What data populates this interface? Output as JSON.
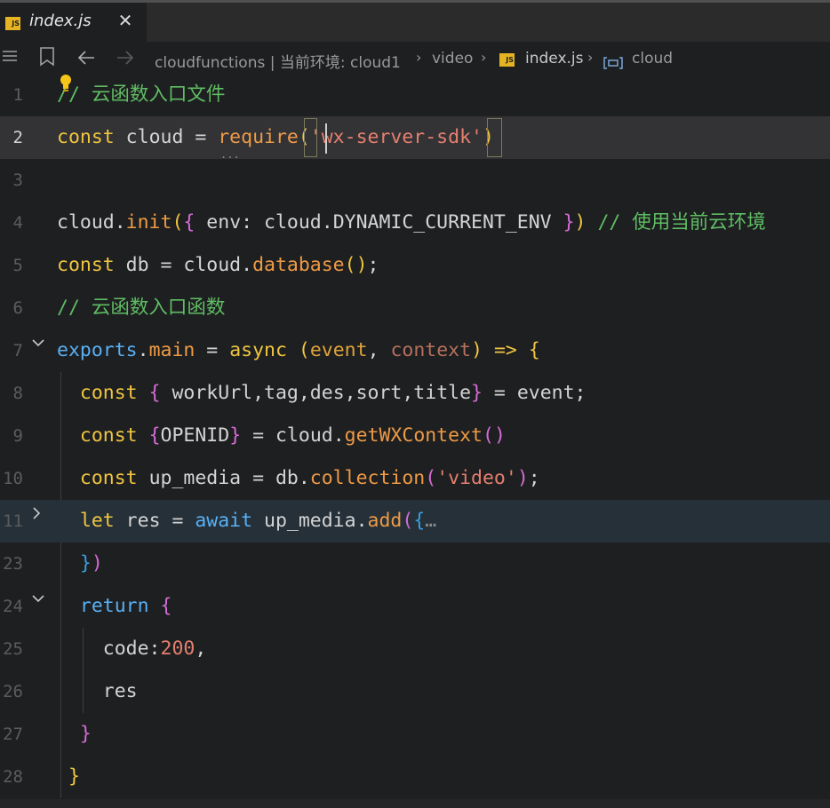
{
  "tab": {
    "icon": "js-file-icon",
    "badge": "JS",
    "name": "index.js",
    "close": "✕"
  },
  "breadcrumb": {
    "icons": [
      "menu-icon",
      "bookmark-icon",
      "back-arrow-icon",
      "forward-arrow-icon"
    ],
    "path": "cloudfunctions | 当前环境: cloud1",
    "folder": "video",
    "file": "index.js",
    "symbol_icon": "symbol-variable-icon",
    "symbol": "cloud"
  },
  "lines": [
    {
      "num": "1",
      "text": "// 云函数入口文件"
    },
    {
      "num": "2",
      "text": "const cloud = require('wx-server-sdk')"
    },
    {
      "num": "3",
      "text": ""
    },
    {
      "num": "4",
      "text": "cloud.init({ env: cloud.DYNAMIC_CURRENT_ENV }) // 使用当前云环境"
    },
    {
      "num": "5",
      "text": "const db = cloud.database();"
    },
    {
      "num": "6",
      "text": "// 云函数入口函数"
    },
    {
      "num": "7",
      "text": "exports.main = async (event, context) => {"
    },
    {
      "num": "8",
      "text": "  const { workUrl,tag,des,sort,title} = event;"
    },
    {
      "num": "9",
      "text": "  const {OPENID} = cloud.getWXContext()"
    },
    {
      "num": "10",
      "text": "  const up_media = db.collection('video');"
    },
    {
      "num": "11",
      "text": "  let res = await up_media.add({…"
    },
    {
      "num": "23",
      "text": "  })"
    },
    {
      "num": "24",
      "text": "  return {"
    },
    {
      "num": "25",
      "text": "    code:200,"
    },
    {
      "num": "26",
      "text": "    res"
    },
    {
      "num": "27",
      "text": "  }"
    },
    {
      "num": "28",
      "text": " }"
    }
  ],
  "theme": {
    "background": "#1e1f21",
    "keyword": "#f0c53f",
    "string": "#e57f6e",
    "comment": "#5fbd63",
    "function": "#ee9a45"
  }
}
